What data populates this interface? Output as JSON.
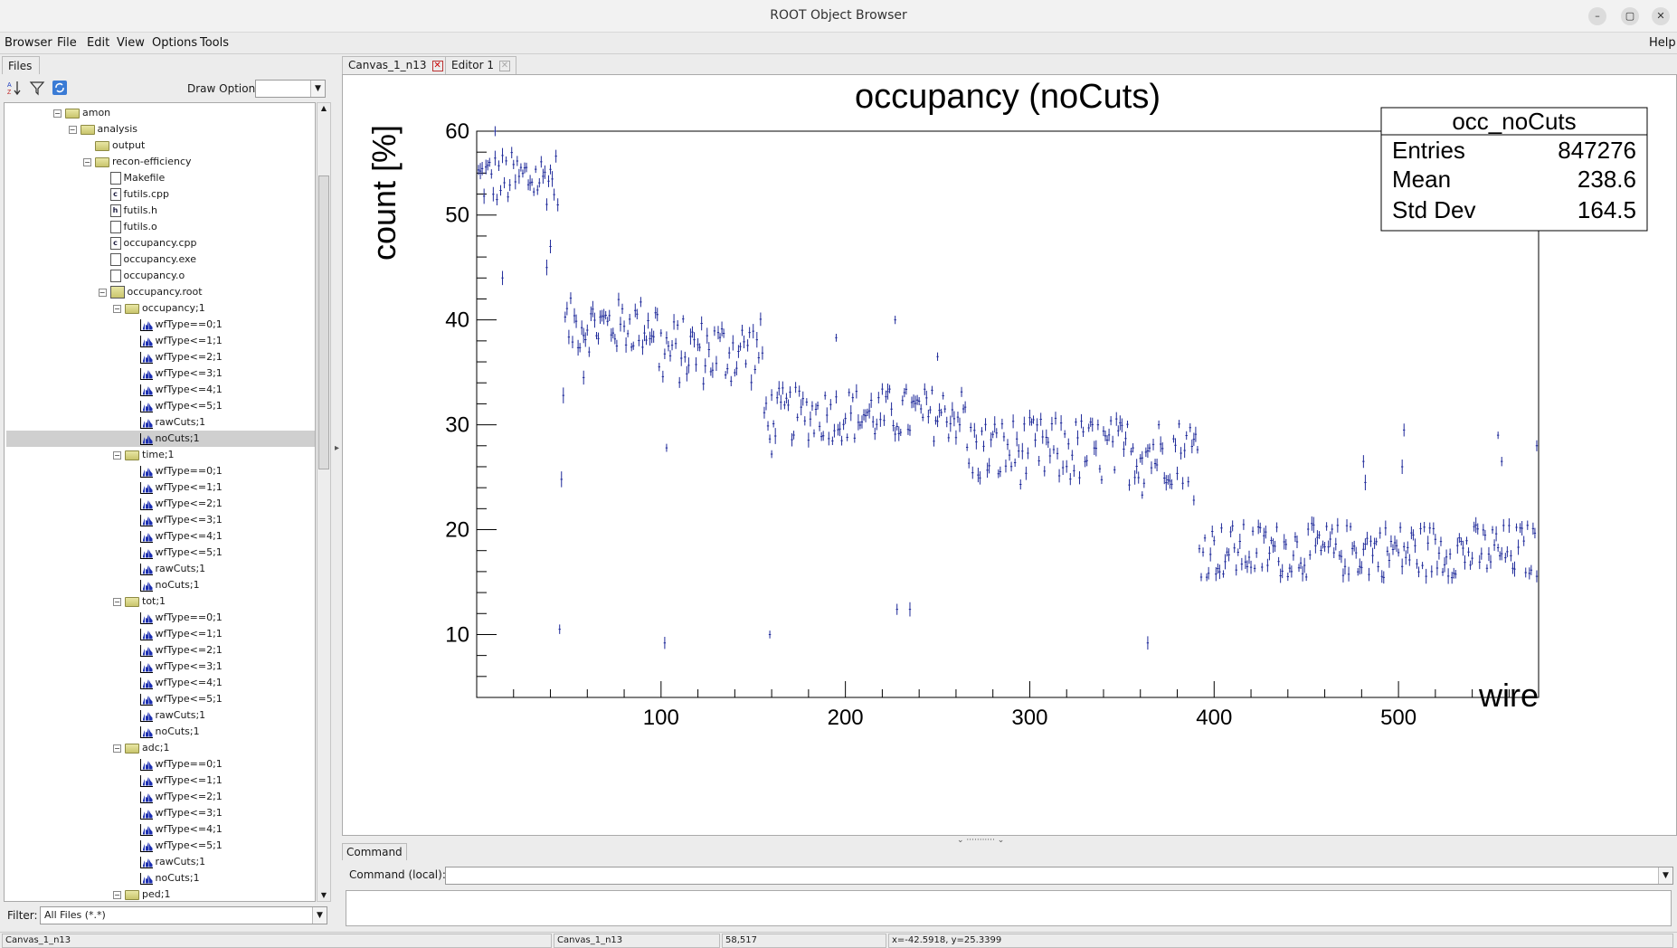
{
  "window": {
    "title": "ROOT Object Browser",
    "buttons": [
      "–",
      "▢",
      "✕"
    ]
  },
  "menu": {
    "items": [
      "Browser",
      "File",
      "Edit",
      "View",
      "Options",
      "Tools"
    ],
    "help": "Help"
  },
  "left": {
    "tab": "Files",
    "draw_option_label": "Draw Option:",
    "filter_label": "Filter:",
    "filter_value": "All Files (*.*)"
  },
  "tree": [
    {
      "label": "amon",
      "indent": 0,
      "icon": "folder",
      "exp": "-"
    },
    {
      "label": "analysis",
      "indent": 1,
      "icon": "folder",
      "exp": "-"
    },
    {
      "label": "output",
      "indent": 2,
      "icon": "folder",
      "exp": ""
    },
    {
      "label": "recon-efficiency",
      "indent": 2,
      "icon": "folder",
      "exp": "-"
    },
    {
      "label": "Makefile",
      "indent": 3,
      "icon": "file",
      "exp": ""
    },
    {
      "label": "futils.cpp",
      "indent": 3,
      "icon": "cfile",
      "exp": ""
    },
    {
      "label": "futils.h",
      "indent": 3,
      "icon": "hfile",
      "exp": ""
    },
    {
      "label": "futils.o",
      "indent": 3,
      "icon": "file",
      "exp": ""
    },
    {
      "label": "occupancy.cpp",
      "indent": 3,
      "icon": "cfile",
      "exp": ""
    },
    {
      "label": "occupancy.exe",
      "indent": 3,
      "icon": "file",
      "exp": ""
    },
    {
      "label": "occupancy.o",
      "indent": 3,
      "icon": "file",
      "exp": ""
    },
    {
      "label": "occupancy.root",
      "indent": 3,
      "icon": "rootfile",
      "exp": "-"
    },
    {
      "label": "occupancy;1",
      "indent": 4,
      "icon": "folder",
      "exp": "-"
    },
    {
      "label": "wfType==0;1",
      "indent": 5,
      "icon": "hist",
      "exp": ""
    },
    {
      "label": "wfType<=1;1",
      "indent": 5,
      "icon": "hist",
      "exp": ""
    },
    {
      "label": "wfType<=2;1",
      "indent": 5,
      "icon": "hist",
      "exp": ""
    },
    {
      "label": "wfType<=3;1",
      "indent": 5,
      "icon": "hist",
      "exp": ""
    },
    {
      "label": "wfType<=4;1",
      "indent": 5,
      "icon": "hist",
      "exp": ""
    },
    {
      "label": "wfType<=5;1",
      "indent": 5,
      "icon": "hist",
      "exp": ""
    },
    {
      "label": "rawCuts;1",
      "indent": 5,
      "icon": "hist",
      "exp": ""
    },
    {
      "label": "noCuts;1",
      "indent": 5,
      "icon": "hist",
      "exp": "",
      "selected": true
    },
    {
      "label": "time;1",
      "indent": 4,
      "icon": "folder",
      "exp": "-"
    },
    {
      "label": "wfType==0;1",
      "indent": 5,
      "icon": "hist",
      "exp": ""
    },
    {
      "label": "wfType<=1;1",
      "indent": 5,
      "icon": "hist",
      "exp": ""
    },
    {
      "label": "wfType<=2;1",
      "indent": 5,
      "icon": "hist",
      "exp": ""
    },
    {
      "label": "wfType<=3;1",
      "indent": 5,
      "icon": "hist",
      "exp": ""
    },
    {
      "label": "wfType<=4;1",
      "indent": 5,
      "icon": "hist",
      "exp": ""
    },
    {
      "label": "wfType<=5;1",
      "indent": 5,
      "icon": "hist",
      "exp": ""
    },
    {
      "label": "rawCuts;1",
      "indent": 5,
      "icon": "hist",
      "exp": ""
    },
    {
      "label": "noCuts;1",
      "indent": 5,
      "icon": "hist",
      "exp": ""
    },
    {
      "label": "tot;1",
      "indent": 4,
      "icon": "folder",
      "exp": "-"
    },
    {
      "label": "wfType==0;1",
      "indent": 5,
      "icon": "hist",
      "exp": ""
    },
    {
      "label": "wfType<=1;1",
      "indent": 5,
      "icon": "hist",
      "exp": ""
    },
    {
      "label": "wfType<=2;1",
      "indent": 5,
      "icon": "hist",
      "exp": ""
    },
    {
      "label": "wfType<=3;1",
      "indent": 5,
      "icon": "hist",
      "exp": ""
    },
    {
      "label": "wfType<=4;1",
      "indent": 5,
      "icon": "hist",
      "exp": ""
    },
    {
      "label": "wfType<=5;1",
      "indent": 5,
      "icon": "hist",
      "exp": ""
    },
    {
      "label": "rawCuts;1",
      "indent": 5,
      "icon": "hist",
      "exp": ""
    },
    {
      "label": "noCuts;1",
      "indent": 5,
      "icon": "hist",
      "exp": ""
    },
    {
      "label": "adc;1",
      "indent": 4,
      "icon": "folder",
      "exp": "-"
    },
    {
      "label": "wfType==0;1",
      "indent": 5,
      "icon": "hist",
      "exp": ""
    },
    {
      "label": "wfType<=1;1",
      "indent": 5,
      "icon": "hist",
      "exp": ""
    },
    {
      "label": "wfType<=2;1",
      "indent": 5,
      "icon": "hist",
      "exp": ""
    },
    {
      "label": "wfType<=3;1",
      "indent": 5,
      "icon": "hist",
      "exp": ""
    },
    {
      "label": "wfType<=4;1",
      "indent": 5,
      "icon": "hist",
      "exp": ""
    },
    {
      "label": "wfType<=5;1",
      "indent": 5,
      "icon": "hist",
      "exp": ""
    },
    {
      "label": "rawCuts;1",
      "indent": 5,
      "icon": "hist",
      "exp": ""
    },
    {
      "label": "noCuts;1",
      "indent": 5,
      "icon": "hist",
      "exp": ""
    },
    {
      "label": "ped;1",
      "indent": 4,
      "icon": "folder",
      "exp": "-"
    }
  ],
  "tabs": [
    {
      "label": "Canvas_1_n13",
      "close": "active"
    },
    {
      "label": "Editor 1",
      "close": "gray"
    }
  ],
  "chart_data": {
    "type": "scatter",
    "title": "occupancy (noCuts)",
    "xlabel": "wire",
    "ylabel": "count [%]",
    "xlim": [
      0,
      576
    ],
    "ylim": [
      4,
      58
    ],
    "xticks": [
      100,
      200,
      300,
      400,
      500
    ],
    "yticks": [
      10,
      20,
      30,
      40,
      50,
      60
    ],
    "marker_color": "#1f2a9a",
    "stats": {
      "name": "occ_noCuts",
      "rows": [
        {
          "label": "Entries",
          "value": "847276"
        },
        {
          "label": "Mean",
          "value": "238.6"
        },
        {
          "label": "Std Dev",
          "value": "164.5"
        }
      ]
    },
    "segments": [
      {
        "x0": 1,
        "x1": 44,
        "mean": 53.5,
        "amp": 2.0
      },
      {
        "x0": 48,
        "x1": 98,
        "mean": 39.5,
        "amp": 2.0
      },
      {
        "x0": 99,
        "x1": 155,
        "mean": 37.0,
        "amp": 2.5
      },
      {
        "x0": 156,
        "x1": 265,
        "mean": 31.0,
        "amp": 2.0
      },
      {
        "x0": 266,
        "x1": 391,
        "mean": 27.5,
        "amp": 2.5
      },
      {
        "x0": 392,
        "x1": 575,
        "mean": 18.0,
        "amp": 2.0
      }
    ],
    "outliers": [
      {
        "x": 45,
        "y": 10.5
      },
      {
        "x": 46,
        "y": 24.8
      },
      {
        "x": 47,
        "y": 32.8
      },
      {
        "x": 58,
        "y": 34.5
      },
      {
        "x": 102,
        "y": 9.2
      },
      {
        "x": 103,
        "y": 27.8
      },
      {
        "x": 159,
        "y": 10.0
      },
      {
        "x": 160,
        "y": 27.2
      },
      {
        "x": 195,
        "y": 38.3
      },
      {
        "x": 227,
        "y": 40.0
      },
      {
        "x": 228,
        "y": 12.4
      },
      {
        "x": 235,
        "y": 12.4
      },
      {
        "x": 250,
        "y": 36.5
      },
      {
        "x": 364,
        "y": 9.2
      },
      {
        "x": 361,
        "y": 23.3
      },
      {
        "x": 481,
        "y": 26.5
      },
      {
        "x": 482,
        "y": 24.5
      },
      {
        "x": 502,
        "y": 26.0
      },
      {
        "x": 503,
        "y": 29.5
      },
      {
        "x": 554,
        "y": 29.0
      },
      {
        "x": 556,
        "y": 26.5
      },
      {
        "x": 575,
        "y": 28.0
      },
      {
        "x": 38,
        "y": 45.0
      },
      {
        "x": 40,
        "y": 47.0
      },
      {
        "x": 14,
        "y": 44.0
      },
      {
        "x": 10,
        "y": 58.0
      },
      {
        "x": 389,
        "y": 22.8
      }
    ]
  },
  "command": {
    "tab": "Command",
    "label": "Command (local):"
  },
  "status": [
    {
      "text": "Canvas_1_n13"
    },
    {
      "text": "Canvas_1_n13"
    },
    {
      "text": "58,517"
    },
    {
      "text": "x=-42.5918, y=25.3399"
    }
  ]
}
